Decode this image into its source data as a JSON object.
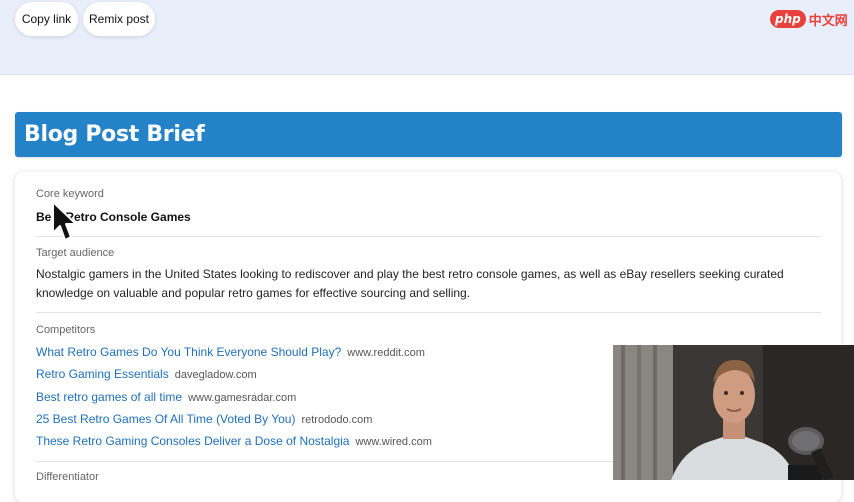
{
  "toolbar": {
    "copy_link": "Copy link",
    "remix_post": "Remix post"
  },
  "watermark": {
    "badge": "php",
    "text": "中文网"
  },
  "header": {
    "title": "Blog Post Brief"
  },
  "brief": {
    "core_keyword_label": "Core keyword",
    "core_keyword": "Best Retro Console Games",
    "target_audience_label": "Target audience",
    "target_audience": "Nostalgic gamers in the United States looking to rediscover and play the best retro console games, as well as eBay resellers seeking curated knowledge on valuable and popular retro games for effective sourcing and selling.",
    "competitors_label": "Competitors",
    "competitors": [
      {
        "title": "What Retro Games Do You Think Everyone Should Play?",
        "domain": "www.reddit.com"
      },
      {
        "title": "Retro Gaming Essentials",
        "domain": "davegladow.com"
      },
      {
        "title": "Best retro games of all time",
        "domain": "www.gamesradar.com"
      },
      {
        "title": "25 Best Retro Games Of All Time (Voted By You)",
        "domain": "retrododo.com"
      },
      {
        "title": "These Retro Gaming Consoles Deliver a Dose of Nostalgia",
        "domain": "www.wired.com"
      }
    ],
    "differentiator_label": "Differentiator"
  },
  "colors": {
    "header": "#2482c9",
    "link": "#1f6fb8",
    "top_band": "#e8eefa"
  },
  "icons": [
    "mouse-cursor-icon"
  ]
}
